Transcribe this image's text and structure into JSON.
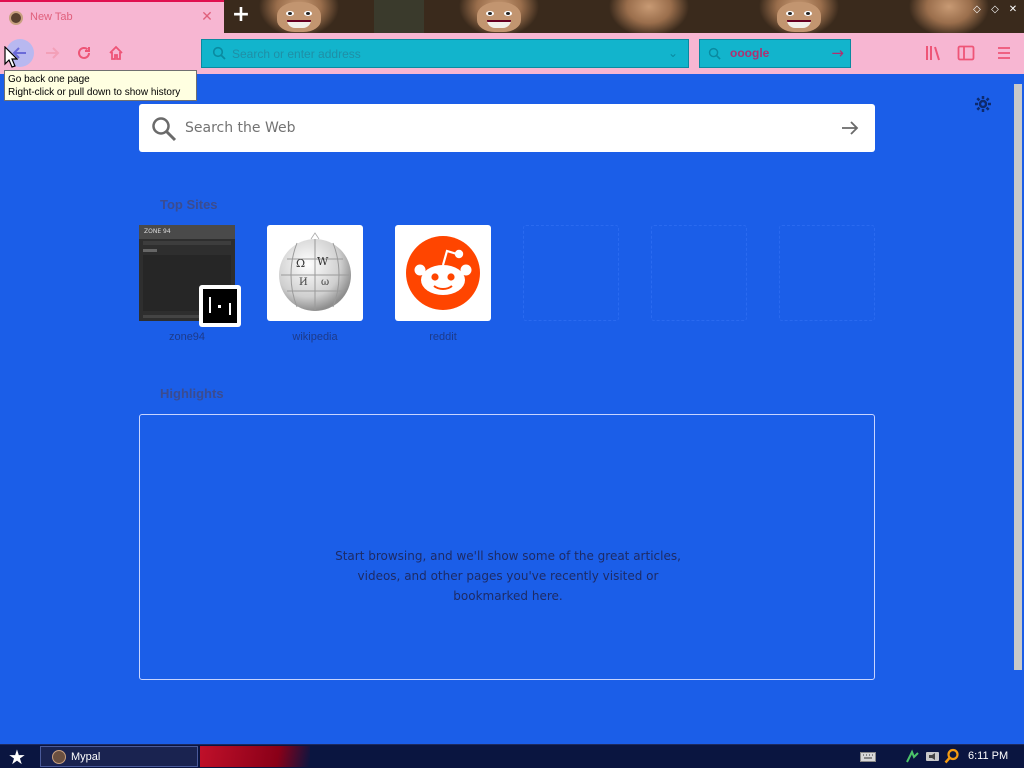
{
  "browser": {
    "tab": {
      "title": "New Tab",
      "close_glyph": "✕"
    },
    "new_tab_glyph": "+",
    "window_buttons": [
      "◇",
      "◇",
      "✕"
    ]
  },
  "navbar": {
    "urlbar_placeholder": "Search or enter address",
    "searchbar_text": "ooogle",
    "icons": [
      "back-icon",
      "forward-icon",
      "reload-icon",
      "home-icon",
      "library-icon",
      "sidebar-icon",
      "menu-icon"
    ]
  },
  "tooltip": {
    "line1": "Go back one page",
    "line2": "Right-click or pull down to show history"
  },
  "newtab": {
    "search_placeholder": "Search the Web",
    "top_sites_title": "Top Sites",
    "top_sites": [
      {
        "label": "zone94"
      },
      {
        "label": "wikipedia"
      },
      {
        "label": "reddit"
      }
    ],
    "highlights_title": "Highlights",
    "highlights_empty": "Start browsing, and we'll show some of the great articles, videos, and other pages you've recently visited or bookmarked here."
  },
  "taskbar": {
    "task_label": "Mypal",
    "clock": "6:11 PM"
  },
  "colors": {
    "page_background": "#1b5ee8",
    "toolbar_pink": "#f7b6d2",
    "urlbar_teal": "#12b4cc",
    "reddit_orange": "#ff4500",
    "taskbar": "#0a1540"
  }
}
